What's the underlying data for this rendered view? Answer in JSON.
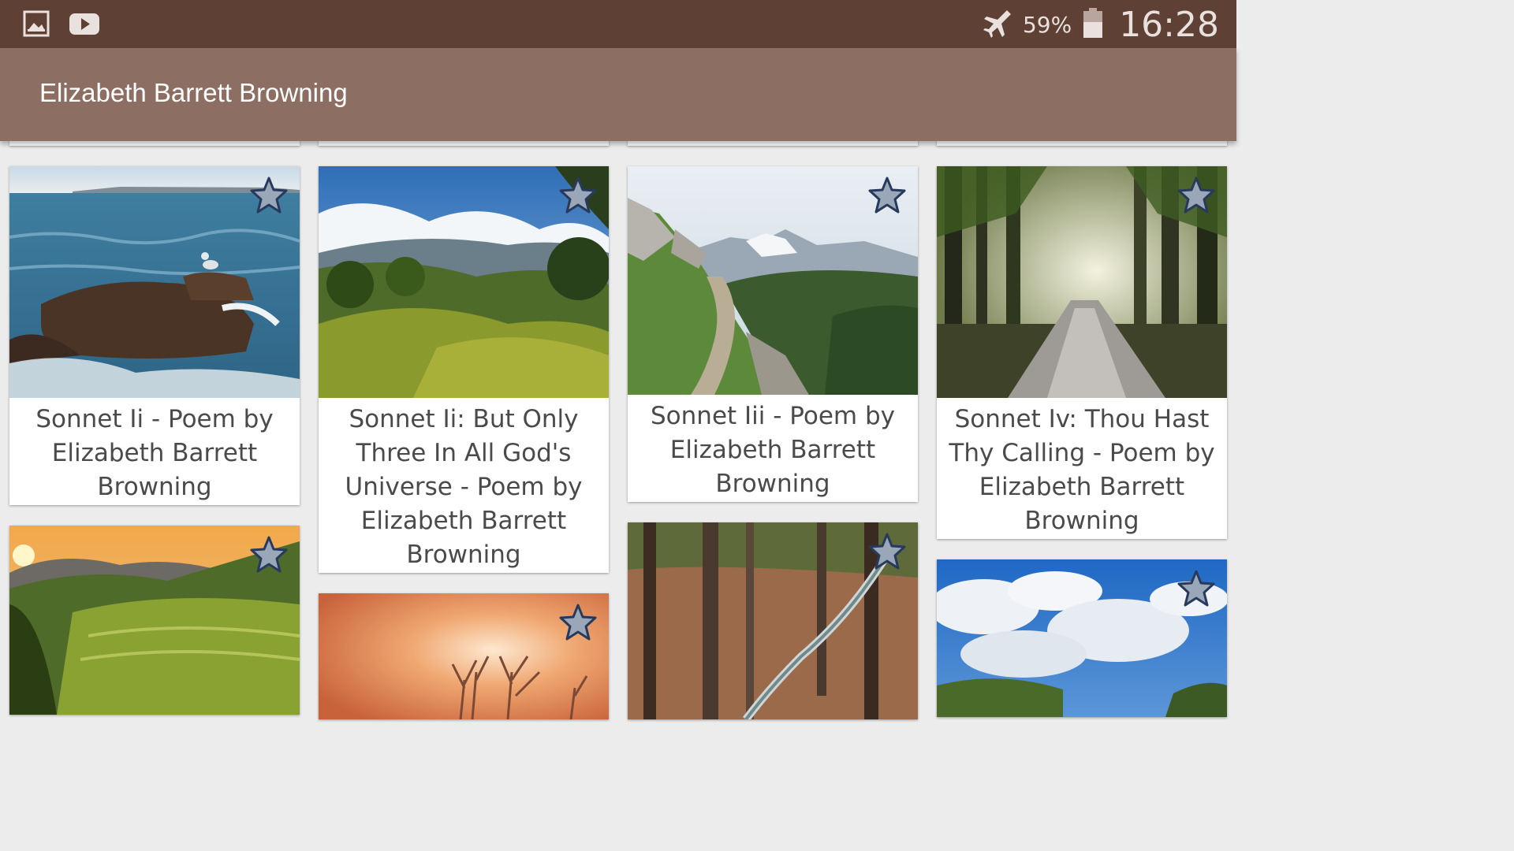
{
  "status_bar": {
    "left_icons": [
      "gallery-icon",
      "youtube-icon"
    ],
    "airplane_icon": "airplane-icon",
    "battery_percent": "59%",
    "battery_icon": "battery-icon",
    "time": "16:28"
  },
  "app_bar": {
    "title": "Elizabeth Barrett Browning"
  },
  "colors": {
    "status_bar": "#5e4034",
    "app_bar": "#8d6e63",
    "background": "#ececec",
    "card": "#ffffff",
    "title_text": "#4a4a4a",
    "star_fill": "#9aa7b8",
    "star_stroke": "#283a5c"
  },
  "cards": [
    {
      "title": "Sonnet Ii - Poem by Elizabeth Barrett Browning",
      "image": "sea-rock-seagull",
      "favorite_icon": "star-icon"
    },
    {
      "title": "Sonnet Ii: But Only Three In All God's Universe - Poem by Elizabeth Barrett Browning",
      "image": "green-hills-clouds",
      "favorite_icon": "star-icon"
    },
    {
      "title": "Sonnet Iii - Poem by Elizabeth Barrett Browning",
      "image": "mountain-trail",
      "favorite_icon": "star-icon"
    },
    {
      "title": "Sonnet Iv: Thou Hast Thy Calling - Poem by Elizabeth Barrett Browning",
      "image": "forest-road-sunbeams",
      "favorite_icon": "star-icon"
    },
    {
      "title": "",
      "image": "terraced-hills-sunset",
      "favorite_icon": "star-icon"
    },
    {
      "title": "",
      "image": "orange-sunset-trees",
      "favorite_icon": "star-icon"
    },
    {
      "title": "",
      "image": "forest-stream",
      "favorite_icon": "star-icon"
    },
    {
      "title": "",
      "image": "blue-sky-clouds",
      "favorite_icon": "star-icon"
    }
  ]
}
